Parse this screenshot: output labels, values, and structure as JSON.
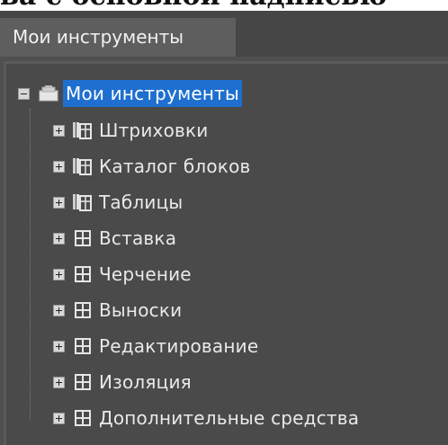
{
  "document_caption": "ва с основной надписью",
  "tab": {
    "label": "Мои инструменты"
  },
  "tree": {
    "root": {
      "label": "Мои инструменты",
      "expanded": true,
      "selected": true,
      "icon": "tool-palette-group-icon"
    },
    "children": [
      {
        "label": "Штриховки",
        "icon": "palette-stack-icon"
      },
      {
        "label": "Каталог блоков",
        "icon": "palette-stack-icon"
      },
      {
        "label": "Таблицы",
        "icon": "palette-stack-icon"
      },
      {
        "label": "Вставка",
        "icon": "palette-grid-icon"
      },
      {
        "label": "Черчение",
        "icon": "palette-grid-icon"
      },
      {
        "label": "Выноски",
        "icon": "palette-grid-icon"
      },
      {
        "label": "Редактирование",
        "icon": "palette-grid-icon"
      },
      {
        "label": "Изоляция",
        "icon": "palette-grid-icon"
      },
      {
        "label": "Дополнительные средства",
        "icon": "palette-grid-icon"
      }
    ]
  },
  "colors": {
    "panel_bg": "#4f4f4f",
    "tab_bg": "#5e5e5e",
    "selection": "#1e6fd0",
    "text": "#e9e9e9"
  }
}
